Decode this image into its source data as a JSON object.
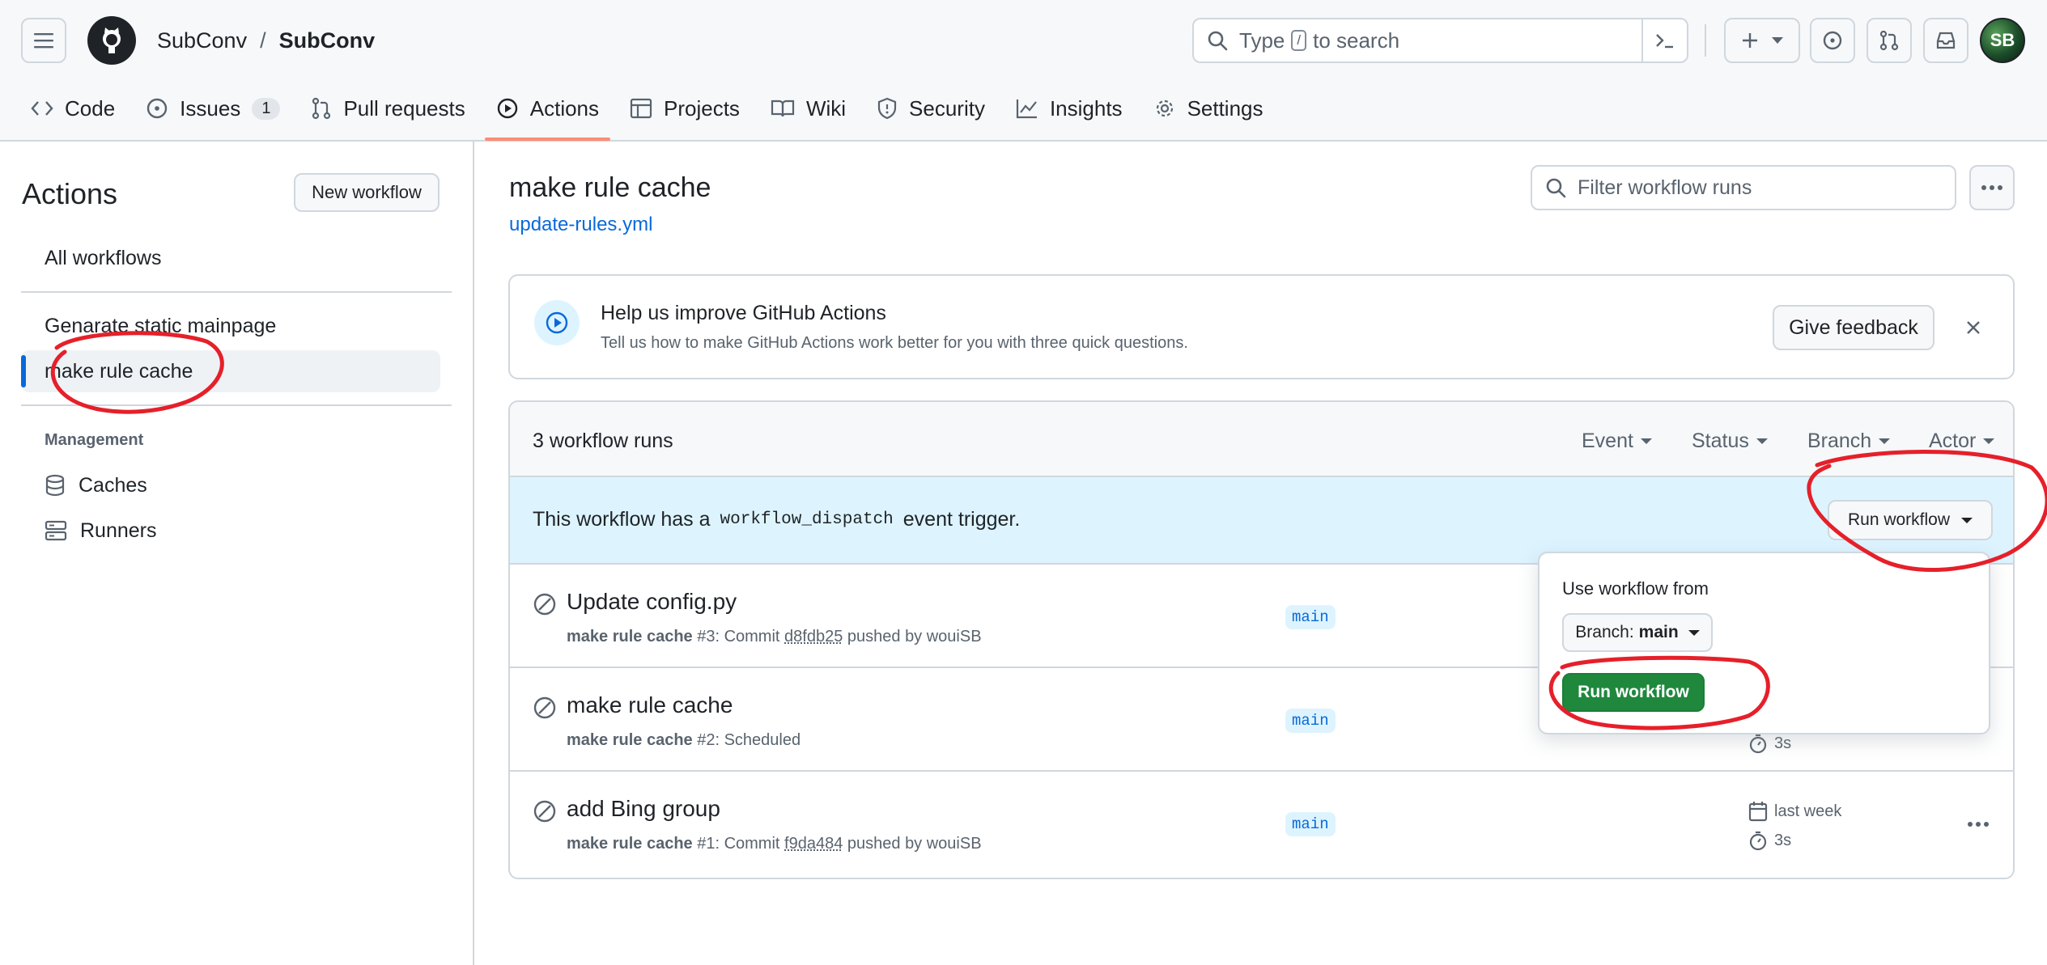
{
  "colors": {
    "accent": "#0969da",
    "green": "#1f883d",
    "annotation_red": "#e5202a",
    "tab_underline": "#fd8c73"
  },
  "header": {
    "owner": "SubConv",
    "separator": "/",
    "repo": "SubConv",
    "search": {
      "before": "Type",
      "key": "/",
      "after": "to search"
    },
    "avatar_text": "SB"
  },
  "tabs": [
    {
      "label": "Code",
      "icon": "code-icon"
    },
    {
      "label": "Issues",
      "icon": "issue-icon",
      "count": "1"
    },
    {
      "label": "Pull requests",
      "icon": "pull-request-icon"
    },
    {
      "label": "Actions",
      "icon": "play-icon",
      "active": true
    },
    {
      "label": "Projects",
      "icon": "table-icon"
    },
    {
      "label": "Wiki",
      "icon": "book-icon"
    },
    {
      "label": "Security",
      "icon": "shield-icon"
    },
    {
      "label": "Insights",
      "icon": "graph-icon"
    },
    {
      "label": "Settings",
      "icon": "gear-icon"
    }
  ],
  "sidebar": {
    "title": "Actions",
    "new_workflow": "New workflow",
    "all_workflows": "All workflows",
    "workflows": [
      "Genarate static mainpage",
      "make rule cache"
    ],
    "management_heading": "Management",
    "management": [
      {
        "label": "Caches",
        "icon": "database-icon"
      },
      {
        "label": "Runners",
        "icon": "server-icon"
      }
    ]
  },
  "main": {
    "title": "make rule cache",
    "file_link": "update-rules.yml",
    "filter_placeholder": "Filter workflow runs",
    "banner": {
      "title": "Help us improve GitHub Actions",
      "description": "Tell us how to make GitHub Actions work better for you with three quick questions.",
      "button": "Give feedback"
    },
    "runs_count": "3 workflow runs",
    "filters": [
      "Event",
      "Status",
      "Branch",
      "Actor"
    ],
    "dispatch": {
      "before": "This workflow has a",
      "code": "workflow_dispatch",
      "after": "event trigger."
    },
    "run_workflow_button": "Run workflow",
    "runs": [
      {
        "title": "Update config.py",
        "workflow": "make rule cache",
        "number": "#3",
        "sub_mid": ": Commit",
        "commit": "d8fdb25",
        "sub_end": "pushed by wouiSB",
        "branch": "main",
        "date": "",
        "duration": ""
      },
      {
        "title": "make rule cache",
        "workflow": "make rule cache",
        "number": "#2",
        "sub_mid": ": Scheduled",
        "commit": "",
        "sub_end": "",
        "branch": "main",
        "date": "",
        "duration": "3s"
      },
      {
        "title": "add Bing group",
        "workflow": "make rule cache",
        "number": "#1",
        "sub_mid": ": Commit",
        "commit": "f9da484",
        "sub_end": "pushed by wouiSB",
        "branch": "main",
        "date": "last week",
        "duration": "3s"
      }
    ]
  },
  "popup": {
    "label": "Use workflow from",
    "branch_prefix": "Branch:",
    "branch_value": "main",
    "run_button": "Run workflow"
  }
}
